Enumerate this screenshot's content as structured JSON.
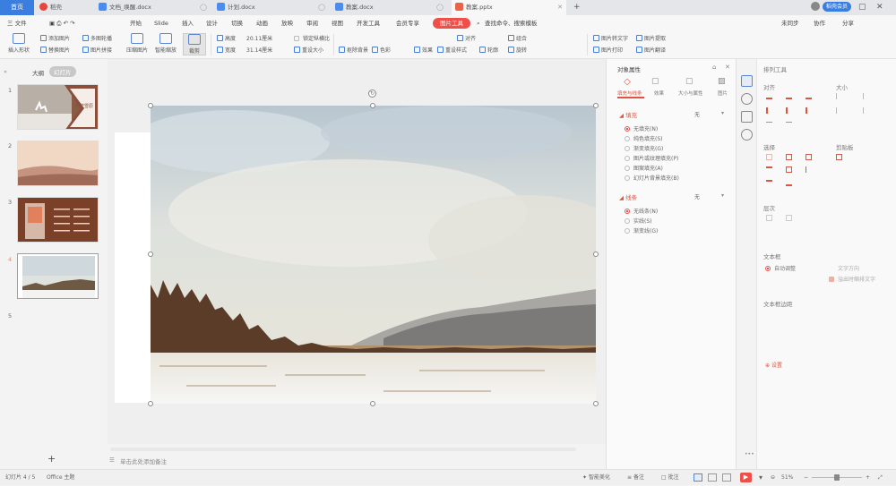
{
  "tabs": {
    "home": "首页",
    "docs": [
      {
        "label": "稻壳",
        "color": "#e8453c"
      },
      {
        "label": "文档_唤醒.docx",
        "color": "#4a8cf0"
      },
      {
        "label": "计划.docx",
        "color": "#4a8cf0"
      },
      {
        "label": "教案.docx",
        "color": "#4a8cf0"
      },
      {
        "label": "教案.pptx",
        "color": "#e8634a"
      }
    ],
    "add": "+"
  },
  "menu": {
    "file": "三 文件",
    "items": [
      "开始",
      "插入",
      "设计",
      "切换",
      "动画",
      "放映",
      "审阅",
      "视图",
      "开发工具",
      "会员专享"
    ],
    "slide": "Slide",
    "active": "图片工具",
    "search": "查找命令、搜索模板",
    "right": [
      "未同步",
      "协作",
      "分享"
    ],
    "user": "稻壳会员"
  },
  "ribbon": {
    "small_left": [
      "添加图片",
      "替换图片",
      "多图轮播",
      "图片拼接",
      "压缩图片",
      "智能缩放"
    ],
    "insert": "插入形状",
    "crop": "裁剪",
    "height_label": "高度",
    "height_val": "20.11厘米",
    "width_label": "宽度",
    "width_val": "31.14厘米",
    "lock_ratio": "锁定纵横比",
    "reset_size": "重设大小",
    "remove_bg": "抠除背景",
    "color": "色彩",
    "effects": "效果",
    "reset_pic": "重设样式",
    "outline": "轮廓",
    "rotate": "旋转",
    "align": "对齐",
    "group": "组合",
    "to_text": "图片转文字",
    "translate": "图片翻译",
    "extract": "图片提取",
    "print": "图片打印"
  },
  "leftpanel": {
    "outline_tab": "大纲",
    "slides_tab": "幻灯片",
    "slide_numbers": [
      "1",
      "2",
      "3",
      "4",
      "5"
    ],
    "slide1_caption": "茫茫雪原",
    "add": "+"
  },
  "objpanel": {
    "title": "对象属性",
    "tabs": [
      "填充与线条",
      "效果",
      "大小与属性",
      "图片"
    ],
    "fill_title": "填充",
    "fill_value": "无",
    "fill_options": [
      "无填充(N)",
      "纯色填充(S)",
      "渐变填充(G)",
      "图片或纹理填充(P)",
      "图案填充(A)",
      "幻灯片背景填充(B)"
    ],
    "line_title": "线条",
    "line_value": "无",
    "line_options": [
      "无线条(N)",
      "实线(S)",
      "渐变线(G)"
    ]
  },
  "toolpanel": {
    "title": "排列工具",
    "align": "对齐",
    "size": "大小",
    "select": "选择",
    "paste": "剪贴板",
    "order": "层次",
    "textbox": "文本框",
    "autofit": "自动调整",
    "shrink": "溢出时缩排文字",
    "text_dir": "文字方向",
    "textbox_margin": "文本框边距",
    "settings": "设置"
  },
  "notes": {
    "placeholder": "单击此处添加备注"
  },
  "status": {
    "slide_count": "幻灯片 4 / 5",
    "theme": "Office 主题",
    "beautify": "智能美化",
    "notes_btn": "备注",
    "comments": "批注",
    "zoom": "51%"
  },
  "colors": {
    "accent": "#f04e49",
    "tab_blue": "#3a7ee0"
  }
}
